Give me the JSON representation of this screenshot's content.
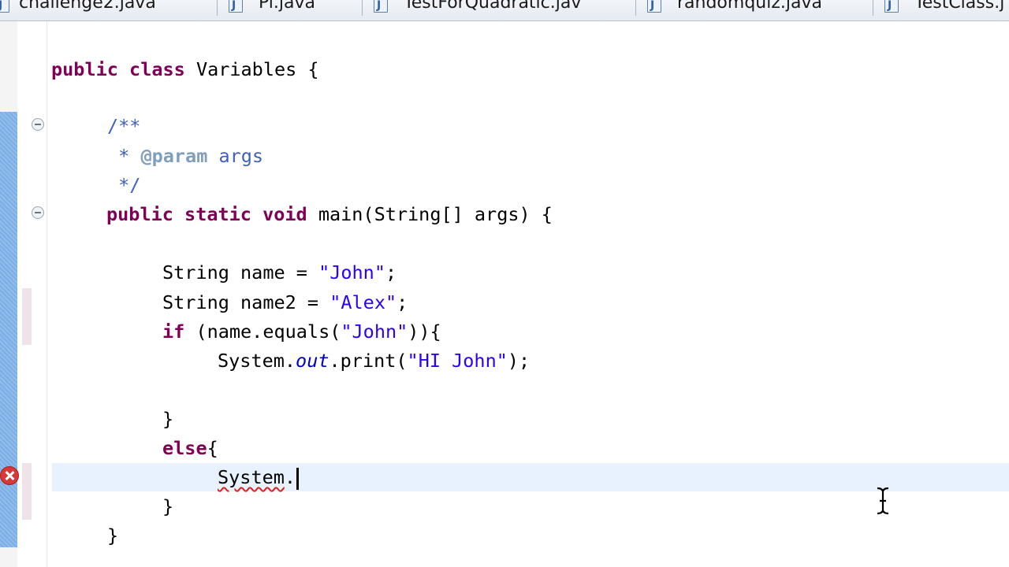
{
  "tabs": [
    {
      "label": "challenge2.java"
    },
    {
      "label": "Pi.java"
    },
    {
      "label": "TestForQuadratic.jav"
    },
    {
      "label": "randomquiz.java"
    },
    {
      "label": "TestClass.j"
    }
  ],
  "code": {
    "line1": {
      "kw1": "public",
      "kw2": "class",
      "text": " Variables {"
    },
    "line2": {
      "text": "/**"
    },
    "line3": {
      "star": " * ",
      "tag": "@param",
      "rest": " args"
    },
    "line4": {
      "text": " */"
    },
    "line5": {
      "kw1": "public",
      "kw2": "static",
      "kw3": "void",
      "text": " main(String[] args) {"
    },
    "line6": {
      "pre": "String name = ",
      "str": "\"John\"",
      "post": ";"
    },
    "line7": {
      "pre": "String name2 = ",
      "str": "\"Alex\"",
      "post": ";"
    },
    "line8": {
      "kw": "if",
      "pre": " (name.equals(",
      "str": "\"John\"",
      "post": ")){"
    },
    "line9": {
      "pre": "System.",
      "field": "out",
      "mid": ".print(",
      "str": "\"HI John\"",
      "post": ");"
    },
    "line10": {
      "text": "}"
    },
    "line11": {
      "kw": "else",
      "post": "{"
    },
    "line12": {
      "err": "System",
      "post": "."
    },
    "line13": {
      "text": "}"
    },
    "line14": {
      "text": "}"
    }
  },
  "colors": {
    "keyword": "#7f0055",
    "string": "#2a00ff",
    "javadoc": "#3f5fbf",
    "javadoc_tag": "#7f9fbf",
    "static_field": "#0000c0",
    "current_line": "#e8f2fe",
    "error": "#d93838"
  },
  "icons": [
    "java-file-icon",
    "fold-collapse-icon",
    "error-icon",
    "text-cursor-icon"
  ]
}
